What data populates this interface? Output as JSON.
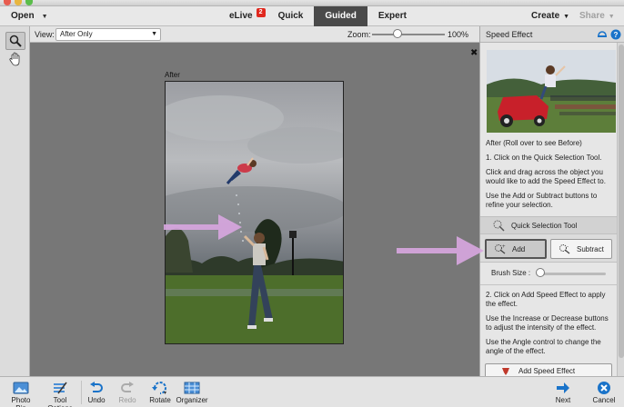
{
  "menubar": {
    "open_label": "Open",
    "modes": [
      {
        "label": "eLive",
        "badge": "2"
      },
      {
        "label": "Quick"
      },
      {
        "label": "Guided",
        "active": true
      },
      {
        "label": "Expert"
      }
    ],
    "create_label": "Create",
    "share_label": "Share"
  },
  "options": {
    "view_label": "View:",
    "view_value": "After Only",
    "zoom_label": "Zoom:",
    "zoom_value": "100%",
    "zoom_level": 0.35
  },
  "canvas": {
    "after_label": "After"
  },
  "panel": {
    "title": "Speed Effect",
    "caption": "After (Roll over to see Before)",
    "step1_title": "1. Click on the Quick Selection Tool.",
    "step1_body": "Click and drag across the object you would like to add the Speed Effect to.",
    "step1_refine": "Use the Add or Subtract buttons to refine your selection.",
    "tool_label": "Quick Selection Tool",
    "add_label": "Add",
    "subtract_label": "Subtract",
    "brush_label": "Brush Size :",
    "brush_level": 0.05,
    "step2_title": "2. Click on Add Speed Effect to apply the effect.",
    "step2_body": "Use the Increase or Decrease buttons to adjust the intensity of the effect.",
    "step2_angle": "Use the Angle control to change the angle of the effect.",
    "add_speed_label": "Add Speed Effect"
  },
  "bottombar": {
    "photo_bin": "Photo Bin",
    "tool_options": "Tool Options",
    "undo": "Undo",
    "redo": "Redo",
    "rotate": "Rotate",
    "organizer": "Organizer",
    "next": "Next",
    "cancel": "Cancel"
  },
  "colors": {
    "accent_blue": "#1a73c9",
    "badge_red": "#e0281e",
    "annotation_arrow": "#d8a6e0",
    "active_mode_bg": "#4a4a4a"
  },
  "icons": [
    "zoom-icon",
    "hand-icon",
    "photo-bin-icon",
    "tool-options-icon",
    "undo-icon",
    "redo-icon",
    "rotate-icon",
    "organizer-icon",
    "next-icon",
    "cancel-icon",
    "quick-selection-icon",
    "brush-add-icon",
    "brush-subtract-icon",
    "speed-effect-icon",
    "reset-icon",
    "help-icon"
  ]
}
